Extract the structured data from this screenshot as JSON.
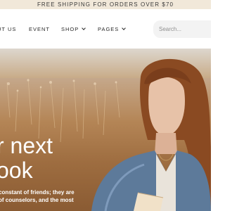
{
  "promo": {
    "text": "FREE SHIPPING FOR ORDERS OVER $70"
  },
  "nav": {
    "items": [
      {
        "label": "UT US"
      },
      {
        "label": "EVENT"
      },
      {
        "label": "SHOP",
        "icon": "chevron-down-icon"
      },
      {
        "label": "PAGES",
        "icon": "chevron-down-icon"
      }
    ]
  },
  "search": {
    "placeholder": "Search..."
  },
  "hero": {
    "title_line1": "r next",
    "title_line2": "ook",
    "body_line1": "constant of friends; they are",
    "body_line2": "of counselors, and the most"
  },
  "colors": {
    "promo_bg": "#f1e8d9",
    "search_bg": "#f3f3f3",
    "hero_text": "#ffffff"
  }
}
